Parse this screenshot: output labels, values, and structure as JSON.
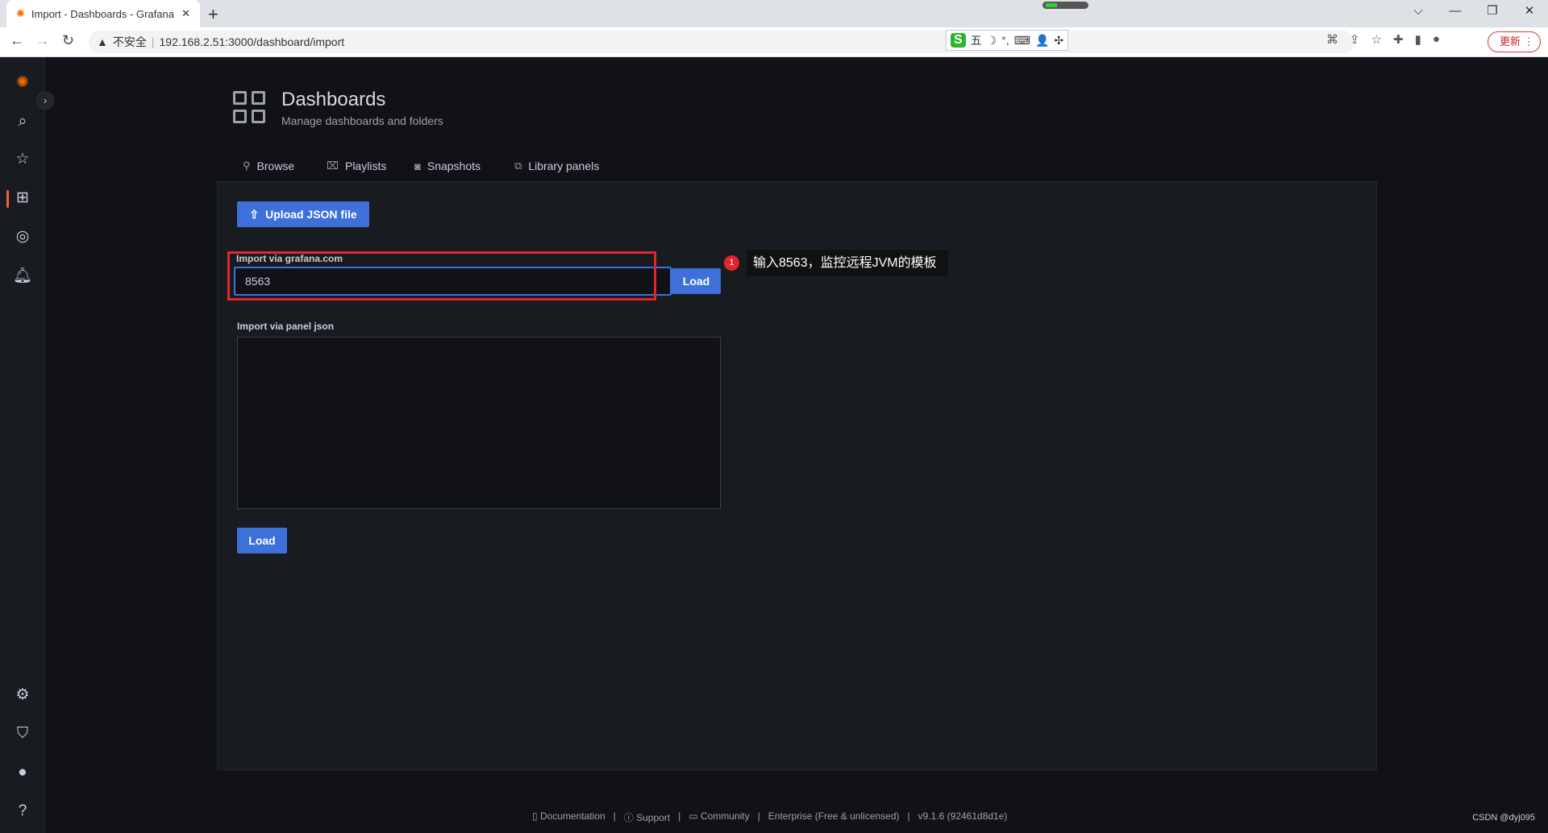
{
  "browser": {
    "tab_title": "Import - Dashboards - Grafana",
    "security_label": "不安全",
    "url": "192.168.2.51:3000/dashboard/import",
    "update_label": "更新",
    "ime_items": [
      "S",
      "五",
      "☽",
      "°,",
      "⌨",
      "👤",
      "✣"
    ]
  },
  "sidebar": {
    "items": [
      "grafana-logo",
      "search",
      "starred",
      "dashboards",
      "explore",
      "alerting"
    ],
    "bottom": [
      "configuration",
      "server-admin",
      "profile",
      "help"
    ]
  },
  "header": {
    "title": "Dashboards",
    "subtitle": "Manage dashboards and folders"
  },
  "tabs": [
    {
      "label": "Browse"
    },
    {
      "label": "Playlists"
    },
    {
      "label": "Snapshots"
    },
    {
      "label": "Library panels"
    }
  ],
  "import": {
    "upload_label": "Upload JSON file",
    "grafana_label": "Import via grafana.com",
    "grafana_value": "8563",
    "load_label": "Load",
    "panel_json_label": "Import via panel json",
    "panel_json_value": "",
    "load2_label": "Load"
  },
  "annotation": {
    "number": "1",
    "text": "输入8563，监控远程JVM的模板",
    "highlight_color": "#e3262c"
  },
  "footer": {
    "documentation": "Documentation",
    "support": "Support",
    "community": "Community",
    "edition": "Enterprise (Free & unlicensed)",
    "version": "v9.1.6 (92461d8d1e)"
  },
  "watermark": "CSDN @dyj095",
  "colors": {
    "accent": "#3d71d9",
    "active": "#f55f3e"
  }
}
